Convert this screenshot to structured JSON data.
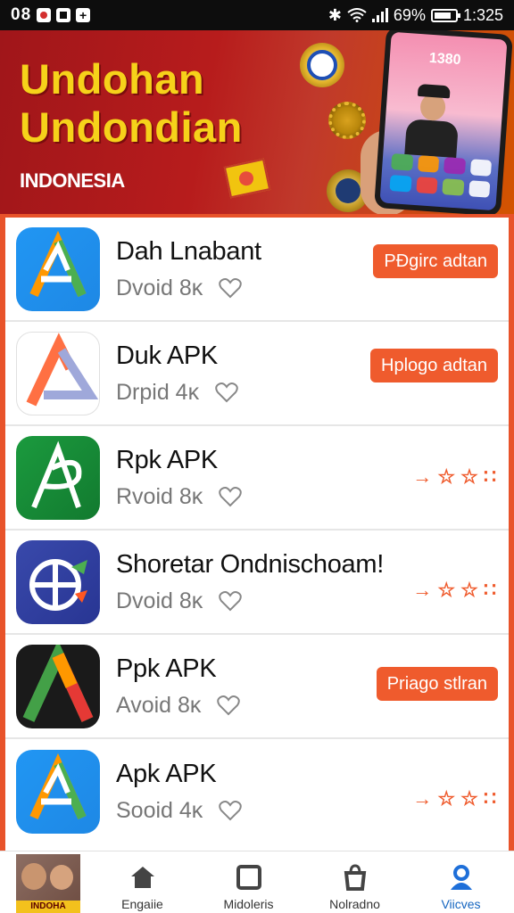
{
  "status_bar": {
    "left_time": "08",
    "battery": "69%",
    "time": "1:325",
    "icons": [
      "record-icon",
      "square-icon",
      "plus-icon",
      "bluetooth-icon",
      "wifi-icon",
      "signal-icon",
      "battery-icon"
    ]
  },
  "banner": {
    "title_line1": "Undohan",
    "title_line2": "Undondian",
    "country": "INDONESIA",
    "phone_time": "1380"
  },
  "apps": [
    {
      "name": "Dah Lnabant",
      "meta": "Dvoid 8κ",
      "action": "PÐgirc adtan",
      "action_type": "button",
      "icon": "ic-blue"
    },
    {
      "name": "Duk APK",
      "meta": "Drpid 4κ",
      "action": "Hplogo adtan",
      "action_type": "button",
      "icon": "ic-white"
    },
    {
      "name": "Rpk APK",
      "meta": "Rvoid 8κ",
      "action": "→ ☆ ☆ ∷",
      "action_type": "stars",
      "icon": "ic-green"
    },
    {
      "name": "Shoretar Ondnischoam!",
      "meta": "Dvoid 8κ",
      "action": "→ ☆ ☆ ∷",
      "action_type": "stars",
      "icon": "ic-indigo"
    },
    {
      "name": "Ppk APK",
      "meta": "Avoid 8κ",
      "action": "Priago stlran",
      "action_type": "button",
      "icon": "ic-black"
    },
    {
      "name": "Apk APK",
      "meta": "Sooid 4κ",
      "action": "→ ☆ ☆ ∷",
      "action_type": "stars",
      "icon": "ic-blue"
    }
  ],
  "bottom_nav": {
    "thumb_caption": "INDOHA",
    "items": [
      {
        "label": "Engaiie",
        "icon": "home-icon"
      },
      {
        "label": "Midoleris",
        "icon": "square-icon"
      },
      {
        "label": "Nolradno",
        "icon": "bag-icon"
      },
      {
        "label": "Viicves",
        "icon": "profile-icon",
        "active": true
      }
    ]
  },
  "colors": {
    "accent": "#ef5b2d",
    "banner_red": "#b71c1c",
    "title_yellow": "#f6d21a",
    "active_nav": "#1565c0"
  }
}
